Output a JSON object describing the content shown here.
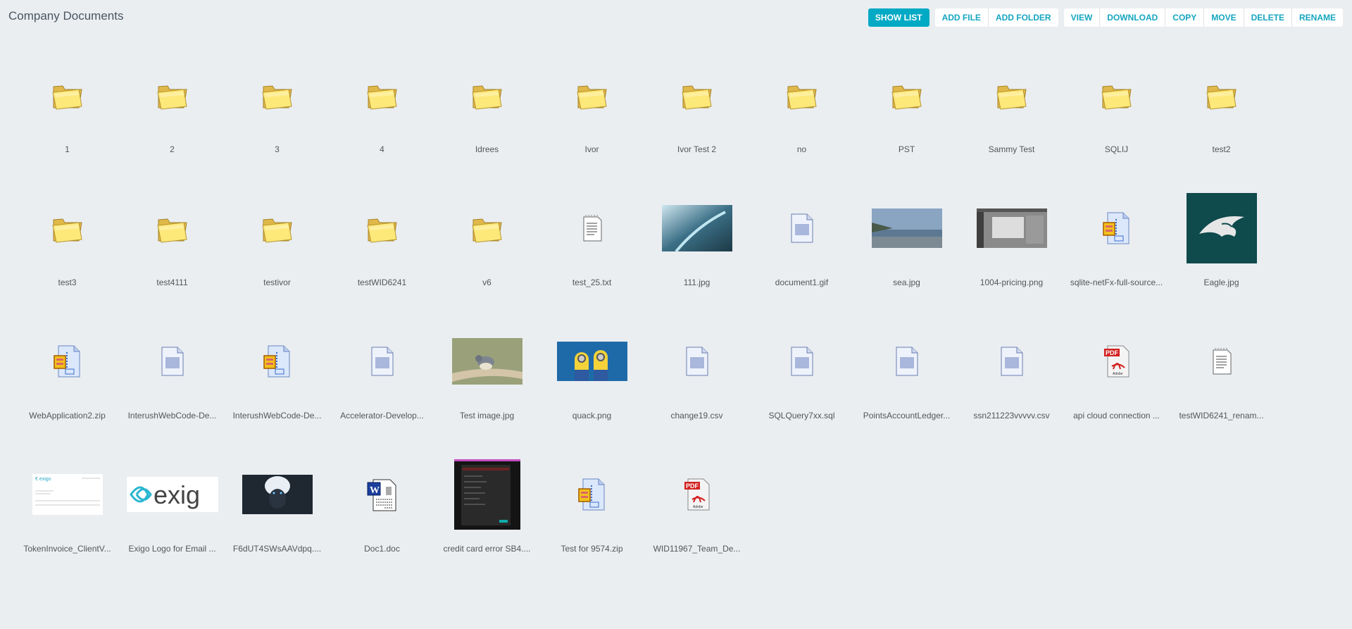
{
  "title": "Company Documents",
  "toolbar": {
    "show_list": "SHOW LIST",
    "add_file": "ADD FILE",
    "add_folder": "ADD FOLDER",
    "view": "VIEW",
    "download": "DOWNLOAD",
    "copy": "COPY",
    "move": "MOVE",
    "delete": "DELETE",
    "rename": "RENAME"
  },
  "items": [
    {
      "name": "1",
      "type": "folder"
    },
    {
      "name": "2",
      "type": "folder"
    },
    {
      "name": "3",
      "type": "folder"
    },
    {
      "name": "4",
      "type": "folder"
    },
    {
      "name": "Idrees",
      "type": "folder"
    },
    {
      "name": "Ivor",
      "type": "folder"
    },
    {
      "name": "Ivor Test 2",
      "type": "folder"
    },
    {
      "name": "no",
      "type": "folder"
    },
    {
      "name": "PST",
      "type": "folder"
    },
    {
      "name": "Sammy Test",
      "type": "folder"
    },
    {
      "name": "SQLIJ",
      "type": "folder"
    },
    {
      "name": "test2",
      "type": "folder"
    },
    {
      "name": "test3",
      "type": "folder"
    },
    {
      "name": "test4111",
      "type": "folder"
    },
    {
      "name": "testivor",
      "type": "folder"
    },
    {
      "name": "testWID6241",
      "type": "folder"
    },
    {
      "name": "v6",
      "type": "folder"
    },
    {
      "name": "test_25.txt",
      "type": "txt"
    },
    {
      "name": "111.jpg",
      "type": "img",
      "thumb": "valley"
    },
    {
      "name": "document1.gif",
      "type": "doc"
    },
    {
      "name": "sea.jpg",
      "type": "img",
      "thumb": "sea"
    },
    {
      "name": "1004-pricing.png",
      "type": "img",
      "thumb": "screen"
    },
    {
      "name": "sqlite-netFx-full-source...",
      "type": "zip"
    },
    {
      "name": "Eagle.jpg",
      "type": "img",
      "thumb": "eagle"
    },
    {
      "name": "WebApplication2.zip",
      "type": "zip"
    },
    {
      "name": "InterushWebCode-De...",
      "type": "doc"
    },
    {
      "name": "InterushWebCode-De...",
      "type": "zip"
    },
    {
      "name": "Accelerator-Develop...",
      "type": "doc"
    },
    {
      "name": "Test image.jpg",
      "type": "img",
      "thumb": "bird"
    },
    {
      "name": "quack.png",
      "type": "img",
      "thumb": "minions"
    },
    {
      "name": "change19.csv",
      "type": "doc"
    },
    {
      "name": "SQLQuery7xx.sql",
      "type": "doc"
    },
    {
      "name": "PointsAccountLedger...",
      "type": "doc"
    },
    {
      "name": "ssn211223vvvvv.csv",
      "type": "doc"
    },
    {
      "name": "api cloud connection ...",
      "type": "pdf"
    },
    {
      "name": "testWID6241_renam...",
      "type": "txt"
    },
    {
      "name": "TokenInvoice_ClientV...",
      "type": "img",
      "thumb": "invoice"
    },
    {
      "name": "Exigo Logo for Email ...",
      "type": "img",
      "thumb": "exigo"
    },
    {
      "name": "F6dUT4SWsAAVdpq....",
      "type": "img",
      "thumb": "anime"
    },
    {
      "name": "Doc1.doc",
      "type": "word"
    },
    {
      "name": "credit card error SB4....",
      "type": "img",
      "thumb": "dark"
    },
    {
      "name": "Test for 9574.zip",
      "type": "zip"
    },
    {
      "name": "WID11967_Team_De...",
      "type": "pdf"
    }
  ],
  "logo_text": "exig",
  "pdf_text": "PDF"
}
